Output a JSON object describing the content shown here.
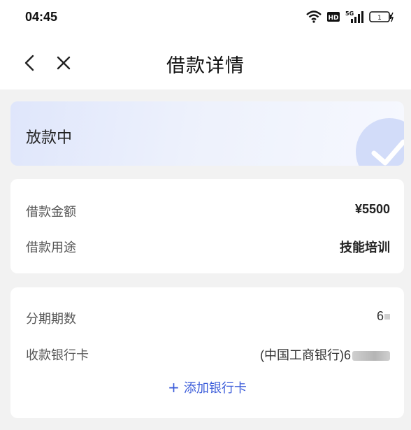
{
  "status_bar": {
    "time": "04:45",
    "icons": [
      "wifi-icon",
      "hd-icon",
      "signal-5g-icon",
      "battery-icon"
    ],
    "battery_level": "1"
  },
  "nav": {
    "title": "借款详情",
    "back_icon": "chevron-left-icon",
    "close_icon": "close-icon"
  },
  "status_card": {
    "text": "放款中",
    "icon": "check-circle-icon"
  },
  "loan_info": {
    "amount_label": "借款金额",
    "amount_value": "¥5500",
    "purpose_label": "借款用途",
    "purpose_value": "技能培训"
  },
  "repayment_info": {
    "installments_label": "分期期数",
    "installments_value": "6",
    "bank_label": "收款银行卡",
    "bank_value": "(中国工商银行)6",
    "add_card_label": "添加银行卡"
  },
  "colors": {
    "accent": "#3a5bd9",
    "page_bg": "#f2f2f2",
    "status_card_bg": "#e4eafb"
  }
}
